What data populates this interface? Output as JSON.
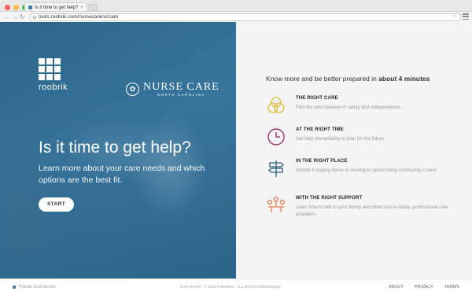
{
  "browser": {
    "tab_title": "Is it time to get help?",
    "url": "tools.roobrik.com/nursecarenc/care"
  },
  "hero": {
    "roobrik_label": "roobrik",
    "partner_name": "NURSE CARE",
    "partner_sub": "NORTH CAROLINA",
    "headline": "Is it time to get help?",
    "subtext": "Learn more about your care needs and which options are the best fit.",
    "start_label": "START"
  },
  "panel": {
    "intro_prefix": "Know more and be better prepared in",
    "intro_bold": "about 4 minutes",
    "items": [
      {
        "title": "THE RIGHT CARE",
        "desc": "Find the best balance of safety and independence.",
        "icon": "venn-circles-icon",
        "color": "#e2b93b"
      },
      {
        "title": "AT THE RIGHT TIME",
        "desc": "Get help immediately or plan for the future.",
        "icon": "clock-icon",
        "color": "#a2336b"
      },
      {
        "title": "IN THE RIGHT PLACE",
        "desc": "Decide if staying home or moving to senior living community is best.",
        "icon": "signpost-icon",
        "color": "#2f5f7e"
      },
      {
        "title": "WITH THE RIGHT SUPPORT",
        "desc": "Learn how to talk to your family and when you're ready, professional care providers.",
        "icon": "people-table-icon",
        "color": "#e57a4e"
      }
    ]
  },
  "footer": {
    "secure_label": "Private and Secure",
    "copyright": "COPYRIGHT © 2016 ROOBRIK. ALL RIGHTS RESERVED",
    "links": [
      "ABOUT",
      "PRIVACY",
      "TERMS"
    ]
  }
}
